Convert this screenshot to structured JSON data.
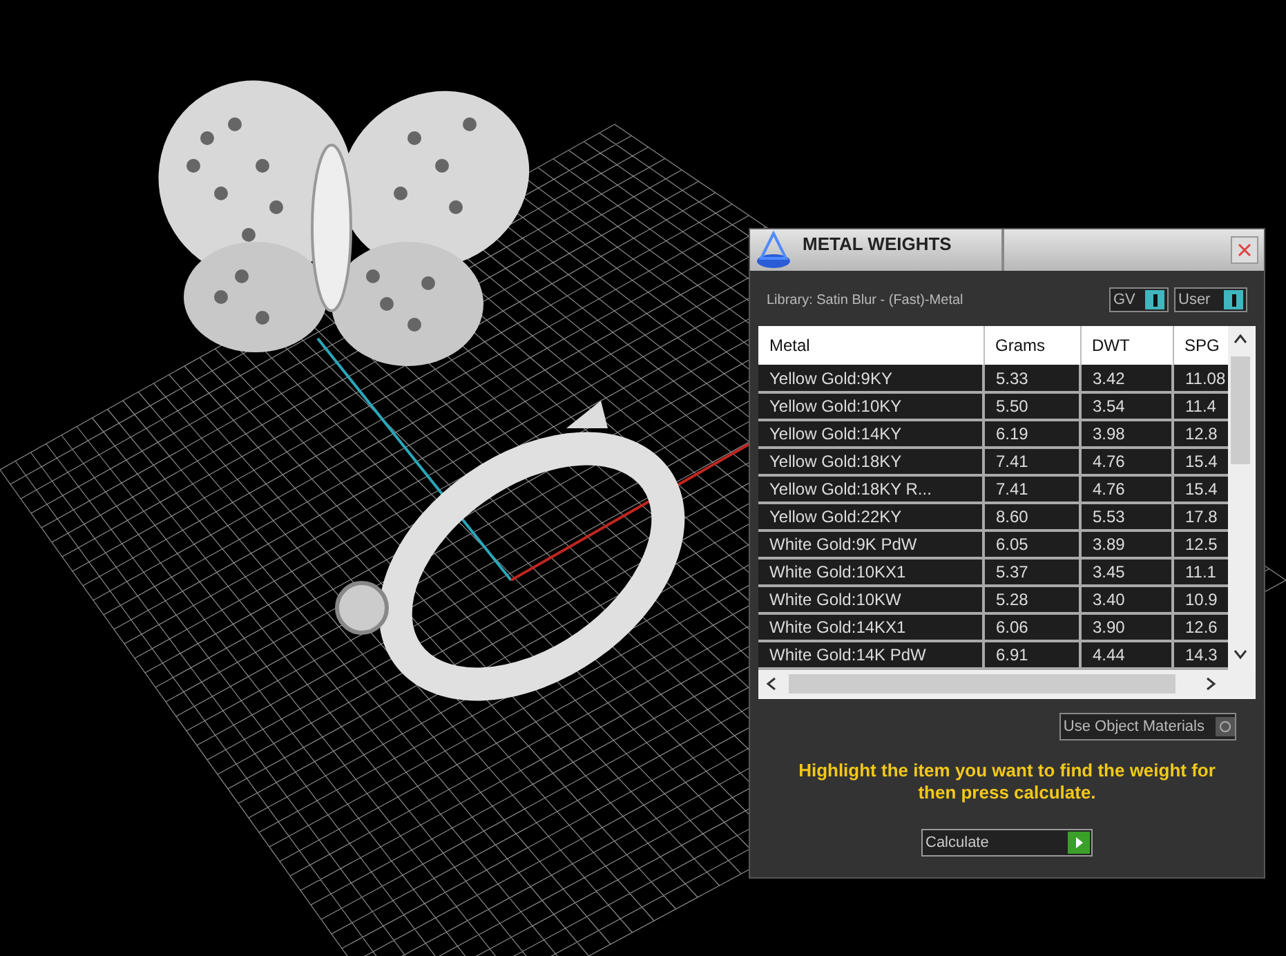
{
  "panel": {
    "title": "METAL WEIGHTS",
    "library": "Library: Satin Blur - (Fast)-Metal",
    "toggles": [
      {
        "label": "GV",
        "on": true
      },
      {
        "label": "User",
        "on": true
      }
    ],
    "table": {
      "columns": [
        "Metal",
        "Grams",
        "DWT",
        "SPG"
      ],
      "rows": [
        [
          "Yellow Gold:9KY",
          "5.33",
          "3.42",
          "11.08"
        ],
        [
          "Yellow Gold:10KY",
          "5.50",
          "3.54",
          "11.4"
        ],
        [
          "Yellow Gold:14KY",
          "6.19",
          "3.98",
          "12.8"
        ],
        [
          "Yellow Gold:18KY",
          "7.41",
          "4.76",
          "15.4"
        ],
        [
          "Yellow Gold:18KY R...",
          "7.41",
          "4.76",
          "15.4"
        ],
        [
          "Yellow Gold:22KY",
          "8.60",
          "5.53",
          "17.8"
        ],
        [
          "White Gold:9K PdW",
          "6.05",
          "3.89",
          "12.5"
        ],
        [
          "White Gold:10KX1",
          "5.37",
          "3.45",
          "11.1"
        ],
        [
          "White Gold:10KW",
          "5.28",
          "3.40",
          "10.9"
        ],
        [
          "White Gold:14KX1",
          "6.06",
          "3.90",
          "12.6"
        ],
        [
          "White Gold:14K PdW",
          "6.91",
          "4.44",
          "14.3"
        ]
      ]
    },
    "use_object_materials": {
      "label": "Use Object Materials",
      "on": false
    },
    "hint": "Highlight the item you want to find the weight for then press calculate.",
    "calculate_button": "Calculate"
  }
}
